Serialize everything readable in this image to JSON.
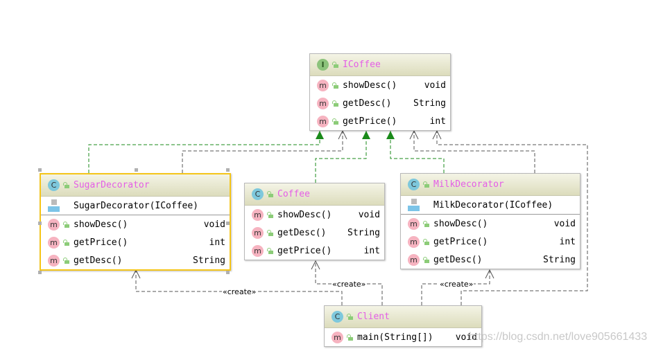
{
  "classes": [
    {
      "id": "icoffee",
      "kind": "I",
      "name": "ICoffee",
      "ctor": null,
      "methods": [
        {
          "sig": "showDesc()",
          "ret": "void"
        },
        {
          "sig": "getDesc()",
          "ret": "String"
        },
        {
          "sig": "getPrice()",
          "ret": "int"
        }
      ]
    },
    {
      "id": "sugar-decorator",
      "kind": "C",
      "name": "SugarDecorator",
      "selected": true,
      "ctor": "SugarDecorator(ICoffee)",
      "methods": [
        {
          "sig": "showDesc()",
          "ret": "void"
        },
        {
          "sig": "getPrice()",
          "ret": "int"
        },
        {
          "sig": "getDesc()",
          "ret": "String"
        }
      ]
    },
    {
      "id": "coffee",
      "kind": "C",
      "name": "Coffee",
      "ctor": null,
      "methods": [
        {
          "sig": "showDesc()",
          "ret": "void"
        },
        {
          "sig": "getDesc()",
          "ret": "String"
        },
        {
          "sig": "getPrice()",
          "ret": "int"
        }
      ]
    },
    {
      "id": "milk-decorator",
      "kind": "C",
      "name": "MilkDecorator",
      "ctor": "MilkDecorator(ICoffee)",
      "methods": [
        {
          "sig": "showDesc()",
          "ret": "void"
        },
        {
          "sig": "getPrice()",
          "ret": "int"
        },
        {
          "sig": "getDesc()",
          "ret": "String"
        }
      ]
    },
    {
      "id": "client",
      "kind": "C",
      "name": "Client",
      "main": true,
      "ctor": null,
      "methods": [
        {
          "sig": "main(String[])",
          "ret": "void"
        }
      ]
    }
  ],
  "edge_labels": {
    "create_sugar": "«create»",
    "create_coffee": "«create»",
    "create_milk": "«create»"
  },
  "colors": {
    "realization": "#1a8a1a",
    "dependency": "#555555",
    "class_name": "#e45ee6",
    "selection": "#f5c518"
  },
  "watermark": "https://blog.csdn.net/love905661433"
}
